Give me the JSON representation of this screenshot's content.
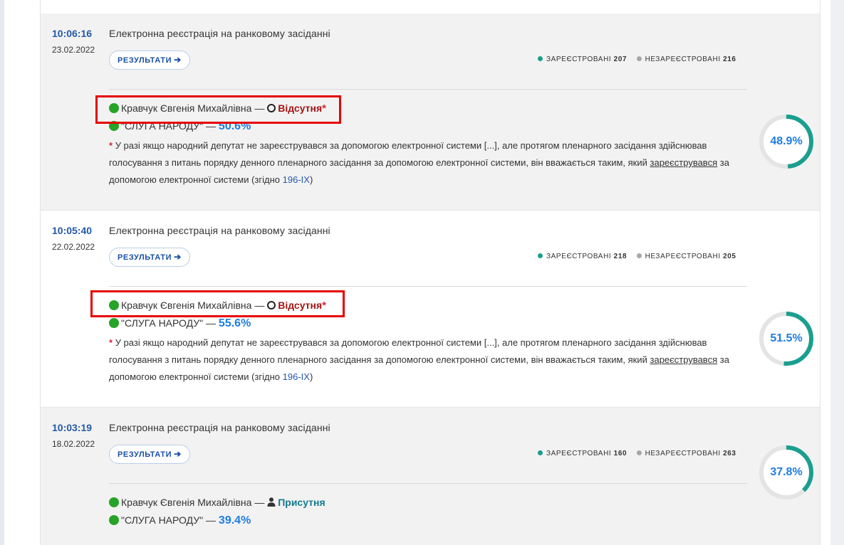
{
  "sessions": [
    {
      "time": "10:06:16",
      "date": "23.02.2022",
      "title": "Електронна реєстрація на ранковому засіданні",
      "results_label": "РЕЗУЛЬТАТИ",
      "registered_label": "ЗАРЕЄСТРОВАНІ",
      "registered_count": "207",
      "unregistered_label": "НЕЗАРЕЄСТРОВАНІ",
      "unregistered_count": "216",
      "deputy_name": "Кравчук Євгенія Михайлівна",
      "dash": "—",
      "status": "Відсутня",
      "status_type": "absent",
      "asterisk": "*",
      "faction_name": "\"СЛУГА НАРОДУ\"",
      "faction_pct": "50.6%",
      "note_star": "*",
      "note_part1": "У разі якщо народний депутат не зареєструвався за допомогою електронної системи [...], але протягом пленарного засідання здійснював голосування з питань порядку денного пленарного засідання за допомогою електронної системи, він вважається таким, який ",
      "note_underlined": "зареєструвався",
      "note_part2": " за допомогою електронної системи (згідно ",
      "note_link": "196-IX",
      "note_part3": ")",
      "gauge_label": "48.9%",
      "gauge_value": 48.9
    },
    {
      "time": "10:05:40",
      "date": "22.02.2022",
      "title": "Електронна реєстрація на ранковому засіданні",
      "results_label": "РЕЗУЛЬТАТИ",
      "registered_label": "ЗАРЕЄСТРОВАНІ",
      "registered_count": "218",
      "unregistered_label": "НЕЗАРЕЄСТРОВАНІ",
      "unregistered_count": "205",
      "deputy_name": "Кравчук Євгенія Михайлівна",
      "dash": "—",
      "status": "Відсутня",
      "status_type": "absent",
      "asterisk": "*",
      "faction_name": "\"СЛУГА НАРОДУ\"",
      "faction_pct": "55.6%",
      "note_star": "*",
      "note_part1": "У разі якщо народний депутат не зареєструвався за допомогою електронної системи [...], але протягом пленарного засідання здійснював голосування з питань порядку денного пленарного засідання за допомогою електронної системи, він вважається таким, який ",
      "note_underlined": "зареєструвався",
      "note_part2": " за допомогою електронної системи (згідно ",
      "note_link": "196-IX",
      "note_part3": ")",
      "gauge_label": "51.5%",
      "gauge_value": 51.5
    },
    {
      "time": "10:03:19",
      "date": "18.02.2022",
      "title": "Електронна реєстрація на ранковому засіданні",
      "results_label": "РЕЗУЛЬТАТИ",
      "registered_label": "ЗАРЕЄСТРОВАНІ",
      "registered_count": "160",
      "unregistered_label": "НЕЗАРЕЄСТРОВАНІ",
      "unregistered_count": "263",
      "deputy_name": "Кравчук Євгенія Михайлівна",
      "dash": "—",
      "status": "Присутня",
      "status_type": "present",
      "faction_name": "\"СЛУГА НАРОДУ\"",
      "faction_pct": "39.4%",
      "gauge_label": "37.8%",
      "gauge_value": 37.8
    }
  ],
  "colors": {
    "teal_gauge": "#1a9e8f",
    "gauge_track": "#e4e4e4",
    "absent": "#a31515",
    "present": "#147a8c",
    "accent_blue": "#1f7de0",
    "highlight_box": "#e60000"
  }
}
